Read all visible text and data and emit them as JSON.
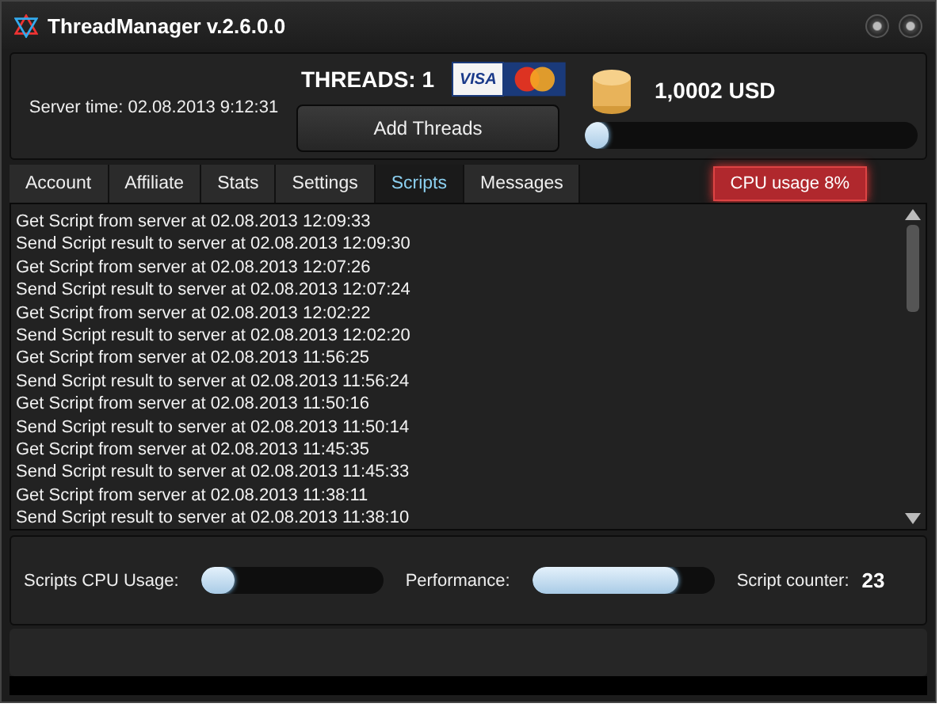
{
  "window": {
    "title": "ThreadManager v.2.6.0.0"
  },
  "header": {
    "server_time": "Server time: 02.08.2013 9:12:31",
    "threads": "THREADS: 1",
    "card_label": "VISA",
    "add_button": "Add Threads",
    "balance": "1,0002 USD",
    "cpu": {
      "level": 0.07,
      "tooltip": "CPU usage 8%"
    }
  },
  "tabs": [
    {
      "label": "Account",
      "selected": false
    },
    {
      "label": "Affiliate",
      "selected": false
    },
    {
      "label": "Stats",
      "selected": false
    },
    {
      "label": "Settings",
      "selected": false
    },
    {
      "label": "Scripts",
      "selected": true
    },
    {
      "label": "Messages",
      "selected": false
    }
  ],
  "log": [
    "Get Script from server at 02.08.2013 12:09:33",
    "Send Script result to server at 02.08.2013 12:09:30",
    "Get Script from server at 02.08.2013 12:07:26",
    "Send Script result to server at 02.08.2013 12:07:24",
    "Get Script from server at 02.08.2013 12:02:22",
    "Send Script result to server at 02.08.2013 12:02:20",
    "Get Script from server at 02.08.2013 11:56:25",
    "Send Script result to server at 02.08.2013 11:56:24",
    "Get Script from server at 02.08.2013 11:50:16",
    "Send Script result to server at 02.08.2013 11:50:14",
    "Get Script from server at 02.08.2013 11:45:35",
    "Send Script result to server at 02.08.2013 11:45:33",
    "Get Script from server at 02.08.2013 11:38:11",
    "Send Script result to server at 02.08.2013 11:38:10"
  ],
  "footer": {
    "cpu_label": "Scripts CPU Usage:",
    "cpu_bar": {
      "level": 0.18
    },
    "perf_label": "Performance:",
    "perf_bar": {
      "level": 0.8
    },
    "counter_label": "Script counter:",
    "counter": "23"
  }
}
